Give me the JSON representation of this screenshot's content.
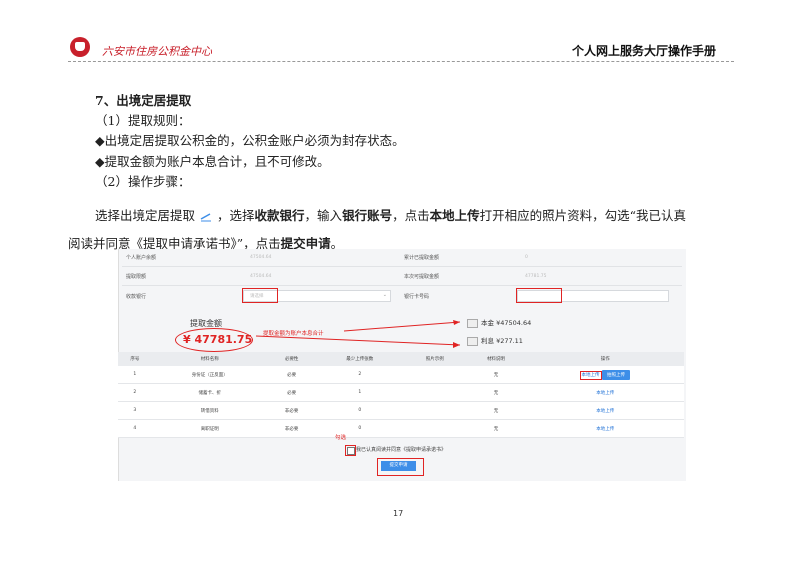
{
  "header": {
    "org": "六安市住房公积金中心",
    "manual": "个人网上服务大厅操作手册"
  },
  "section": {
    "title": "7、出境定居提取",
    "rules_title": "（1）提取规则：",
    "rule1": "◆出境定居提取公积金的，公积金账户必须为封存状态。",
    "rule2": "◆提取金额为账户本息合计，且不可修改。",
    "steps_title": "（2）操作步骤：",
    "p1": "选择出境定居提取",
    "p2": "，选择",
    "p3": "收款银行",
    "p4": "，输入",
    "p5": "银行账号",
    "p6": "，点击",
    "p7": "本地上传",
    "p8": "打开相应的照片资料，勾选“我已认真",
    "p9": "阅读并同意《提取申请承诺书》”，点击",
    "p10": "提交申请",
    "p11": "。"
  },
  "shot": {
    "f1": "个人账户余额",
    "v1": "47504.64",
    "f2": "累计已提取金额",
    "v2": "0",
    "f3": "提取限额",
    "v3": "47504.64",
    "f4": "本次可提取金额",
    "v4": "47781.75",
    "f5": "收款银行",
    "v5": "请选择",
    "f6": "银行卡号码",
    "amount_label": "提取金额",
    "amount": "¥ 47781.75",
    "anno1": "提取金额为账户本息合计",
    "principal": "本金 ¥47504.64",
    "interest": "利息 ¥277.11",
    "table_headers": [
      "序号",
      "材料名称",
      "必要性",
      "最少上传张数",
      "照片示例",
      "材料说明",
      "操作"
    ],
    "rows": [
      {
        "no": "1",
        "name": "身份证（正反面）",
        "need": "必要",
        "min": "2",
        "desc": "无",
        "op": "本地上传",
        "op2": "拍照上传"
      },
      {
        "no": "2",
        "name": "储蓄卡、折",
        "need": "必要",
        "min": "1",
        "desc": "无",
        "op": "本地上传"
      },
      {
        "no": "3",
        "name": "转借资料",
        "need": "非必要",
        "min": "0",
        "desc": "无",
        "op": "本地上传"
      },
      {
        "no": "4",
        "name": "离职证明",
        "need": "非必要",
        "min": "0",
        "desc": "无",
        "op": "本地上传"
      }
    ],
    "anno2": "勾选",
    "agree": "我已认真阅读并同意《提取申请承诺书》",
    "submit": "提交申请"
  },
  "page_number": "17",
  "colors": {
    "brand_red": "#c8202b",
    "annotation_red": "#e02424",
    "link_blue": "#1e70d6",
    "button_blue": "#3d8ee8"
  },
  "icons": [
    "logo-icon",
    "edit-pen-icon",
    "image-placeholder-icon",
    "dropdown-chevron-icon"
  ]
}
